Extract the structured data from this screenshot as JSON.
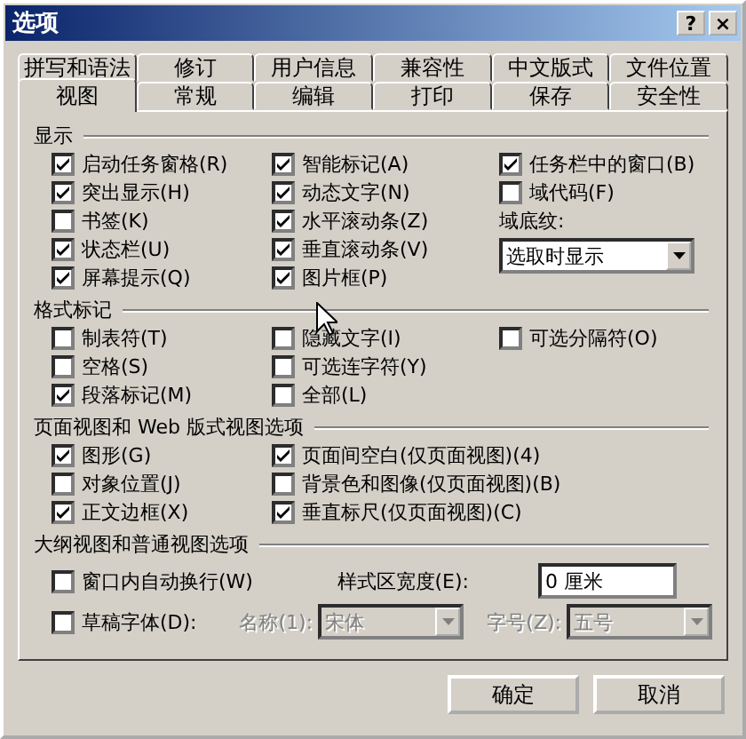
{
  "window": {
    "title": "选项",
    "title_buttons": [
      "?",
      "×"
    ]
  },
  "tab_rows": [
    [
      {
        "label": "拼写和语法",
        "selected": false
      },
      {
        "label": "修订",
        "selected": false
      },
      {
        "label": "用户信息",
        "selected": false
      },
      {
        "label": "兼容性",
        "selected": false
      },
      {
        "label": "中文版式",
        "selected": false
      },
      {
        "label": "文件位置",
        "selected": false
      }
    ],
    [
      {
        "label": "视图",
        "selected": true
      },
      {
        "label": "常规",
        "selected": false
      },
      {
        "label": "编辑",
        "selected": false
      },
      {
        "label": "打印",
        "selected": false
      },
      {
        "label": "保存",
        "selected": false
      },
      {
        "label": "安全性",
        "selected": false
      }
    ]
  ],
  "sections": [
    {
      "title": "显示",
      "kind": "columns",
      "columns": [
        [
          {
            "kind": "checkbox",
            "label": "启动任务窗格(R)",
            "checked": true
          },
          {
            "kind": "checkbox",
            "label": "突出显示(H)",
            "checked": true
          },
          {
            "kind": "checkbox",
            "label": "书签(K)",
            "checked": false
          },
          {
            "kind": "checkbox",
            "label": "状态栏(U)",
            "checked": true
          },
          {
            "kind": "checkbox",
            "label": "屏幕提示(Q)",
            "checked": true
          }
        ],
        [
          {
            "kind": "checkbox",
            "label": "智能标记(A)",
            "checked": true
          },
          {
            "kind": "checkbox",
            "label": "动态文字(N)",
            "checked": true
          },
          {
            "kind": "checkbox",
            "label": "水平滚动条(Z)",
            "checked": true
          },
          {
            "kind": "checkbox",
            "label": "垂直滚动条(V)",
            "checked": true
          },
          {
            "kind": "checkbox",
            "label": "图片框(P)",
            "checked": true
          }
        ],
        [
          {
            "kind": "checkbox",
            "label": "任务栏中的窗口(B)",
            "checked": true
          },
          {
            "kind": "checkbox",
            "label": "域代码(F)",
            "checked": false
          },
          {
            "kind": "label",
            "label": "域底纹:"
          },
          {
            "kind": "dropdown",
            "value": "选取时显示"
          }
        ]
      ]
    },
    {
      "title": "格式标记",
      "kind": "columns",
      "columns": [
        [
          {
            "kind": "checkbox",
            "label": "制表符(T)",
            "checked": false
          },
          {
            "kind": "checkbox",
            "label": "空格(S)",
            "checked": false
          },
          {
            "kind": "checkbox",
            "label": "段落标记(M)",
            "checked": true
          }
        ],
        [
          {
            "kind": "checkbox",
            "label": "隐藏文字(I)",
            "checked": false
          },
          {
            "kind": "checkbox",
            "label": "可选连字符(Y)",
            "checked": false
          },
          {
            "kind": "checkbox",
            "label": "全部(L)",
            "checked": false
          }
        ],
        [
          {
            "kind": "checkbox",
            "label": "可选分隔符(O)",
            "checked": false
          }
        ]
      ]
    },
    {
      "title": "页面视图和 Web 版式视图选项",
      "kind": "columns",
      "columns": [
        [
          {
            "kind": "checkbox",
            "label": "图形(G)",
            "checked": true
          },
          {
            "kind": "checkbox",
            "label": "对象位置(J)",
            "checked": false
          },
          {
            "kind": "checkbox",
            "label": "正文边框(X)",
            "checked": true
          }
        ],
        [
          {
            "kind": "checkbox",
            "label": "页面间空白(仅页面视图)(4)",
            "checked": true
          },
          {
            "kind": "checkbox",
            "label": "背景色和图像(仅页面视图)(B)",
            "checked": false
          },
          {
            "kind": "checkbox",
            "label": "垂直标尺(仅页面视图)(C)",
            "checked": true
          }
        ]
      ]
    },
    {
      "title": "大纲视图和普通视图选项",
      "kind": "rows",
      "rows": [
        [
          {
            "kind": "checkbox",
            "label": "窗口内自动换行(W)",
            "checked": false
          },
          "",
          {
            "kind": "label",
            "label": "样式区宽度(E):"
          },
          {
            "kind": "spinner",
            "value": "0 厘米"
          }
        ],
        [
          {
            "kind": "checkbox",
            "label": "草稿字体(D):",
            "checked": false
          },
          {
            "kind": "label",
            "label": "名称(1):",
            "disabled": true
          },
          {
            "kind": "dropdown",
            "value": "宋体",
            "disabled": true
          },
          {
            "kind": "label",
            "label": "字号(Z):",
            "disabled": true
          },
          {
            "kind": "dropdown",
            "value": "五号",
            "disabled": true
          }
        ]
      ]
    }
  ],
  "buttons": [
    "确定",
    "取消"
  ]
}
